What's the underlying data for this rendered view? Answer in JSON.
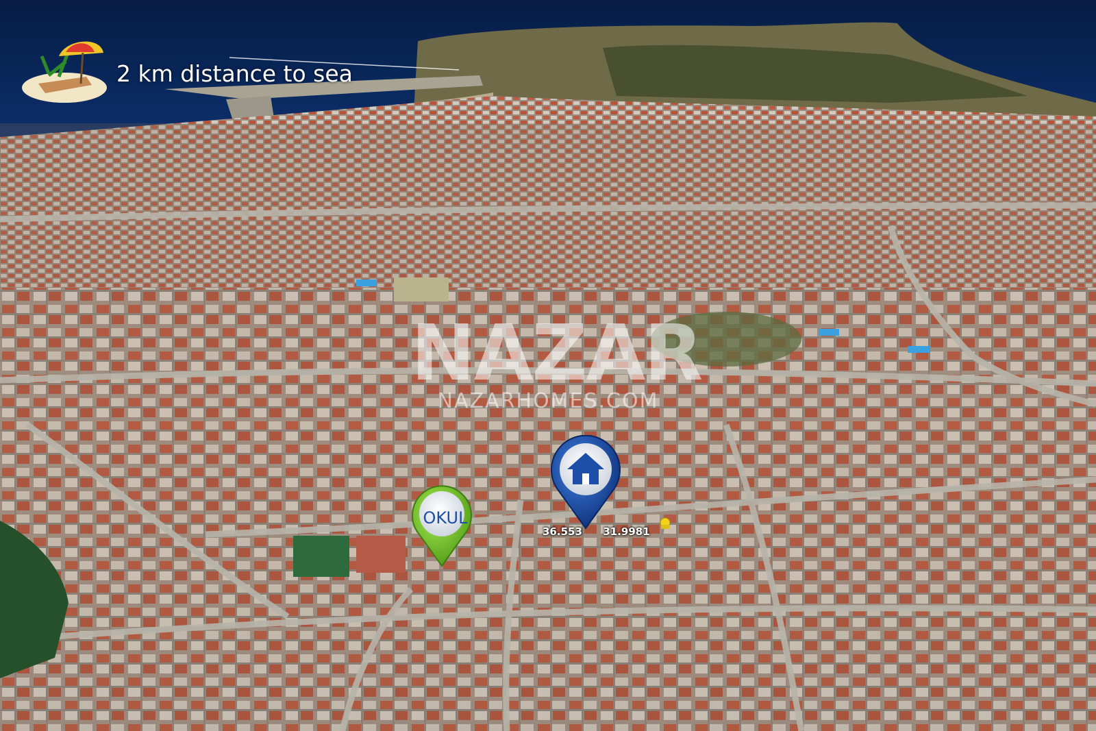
{
  "sea_distance": {
    "icon": "beach-umbrella-icon",
    "label": "2 km distance to sea"
  },
  "watermark": {
    "logo": "NAZAR",
    "url": "NAZARHOMES.COM"
  },
  "markers": {
    "school": {
      "icon": "school-pin-icon",
      "label": "OKUL",
      "color": "#7ec832"
    },
    "home": {
      "icon": "home-pin-icon",
      "color": "#1d4fa8"
    },
    "pushpin": {
      "icon": "pushpin-icon",
      "color": "#f2d21b"
    }
  },
  "coordinates": {
    "lat": "36.553",
    "lon": "31.9981"
  },
  "colors": {
    "sea": "#0b2a5e",
    "roof": "#c8563a",
    "road": "#9a9a92"
  }
}
